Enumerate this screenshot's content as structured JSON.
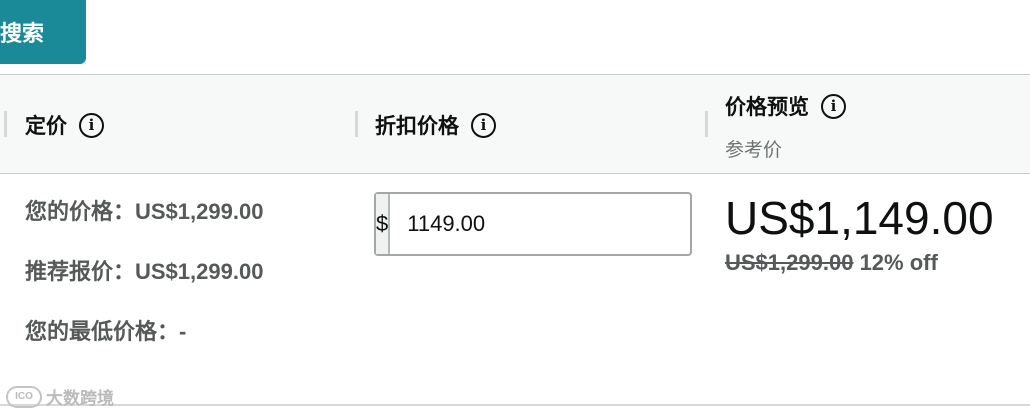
{
  "search_button": {
    "label": "搜索"
  },
  "columns": {
    "list_price": {
      "title": "定价"
    },
    "discount_price": {
      "title": "折扣价格"
    },
    "price_preview": {
      "title": "价格预览",
      "subtitle": "参考价"
    }
  },
  "list_price_values": {
    "your_price": "您的价格：US$1,299.00",
    "recommended_price": "推荐报价：US$1,299.00",
    "your_lowest_price": "您的最低价格：-"
  },
  "discount_input": {
    "currency_symbol": "$",
    "value": "1149.00"
  },
  "preview": {
    "price": "US$1,149.00",
    "original_price": "US$1,299.00",
    "discount_text": "12% off"
  },
  "watermark": {
    "logo": "ICO",
    "text": "大数跨境"
  },
  "colors": {
    "search_button": "#1a8a98",
    "header_bg": "#f7f8f8",
    "muted_text": "#565959"
  },
  "icons": {
    "info": "info-circle-icon"
  }
}
